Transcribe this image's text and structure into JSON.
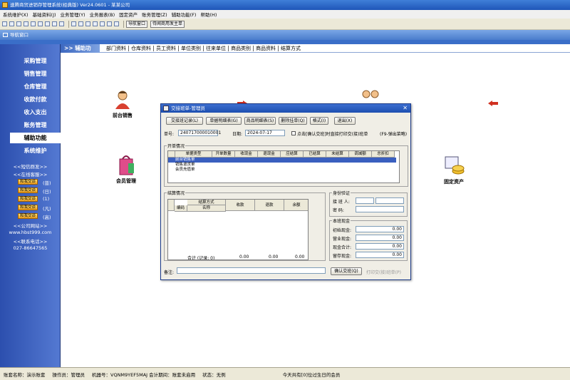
{
  "window": {
    "title": "速腾商贸进销存管理系统(经典版) Ver24.0601 - 某某公司"
  },
  "menu": [
    "系统维护(X)",
    "基础资料(J)",
    "业务管理(Y)",
    "业务报表(B)",
    "固定资产",
    "账务管理(Z)",
    "辅助功能(F)",
    "帮助(H)"
  ],
  "toolbar": {
    "btn_nav": "导航窗口",
    "btn_forum": "侍闻商用发主单"
  },
  "nav": {
    "title": "导航窗口"
  },
  "sidebar": {
    "items": [
      "采购管理",
      "销售管理",
      "仓库管理",
      "收款付款",
      "收入支出",
      "账务管理",
      "辅助功能",
      "系统维护"
    ],
    "active": "辅助功能",
    "sms": "<<短信群发>>",
    "online": "<<在线客服>>",
    "qq": [
      {
        "badge": "和我交谈",
        "label": "(普)"
      },
      {
        "badge": "和我交谈",
        "label": "(日)"
      },
      {
        "badge": "和我交谈",
        "label": "(1)"
      },
      {
        "badge": "和我交谈",
        "label": "(凡)"
      },
      {
        "badge": "和我交谈",
        "label": "(高)"
      }
    ],
    "website_label": "<<公司网站>>",
    "website": "www.hbst999.com",
    "phone_label": "<<联系电话>>",
    "phone": "027-86647565"
  },
  "tabs": {
    "header": ">> 辅助功能",
    "items": [
      "部门资料",
      "仓库资料",
      "员工资料",
      "单位类别",
      "往来单位",
      "商品类别",
      "商品资料",
      "结算方式"
    ]
  },
  "modules": {
    "front_sales": "前台销售",
    "member": "会员管理",
    "fixed_assets": "固定资产"
  },
  "dialog": {
    "title": "交接班单-管理员",
    "buttons": [
      "交接班记录(L)",
      "单据明细表(G)",
      "商品明细表(S)",
      "删除挂单(Q)",
      "格式(I)",
      "退出(X)"
    ],
    "bill_no_label": "单号:",
    "bill_no": "240717000010001",
    "date_label": "日期:",
    "date": "2024-07-17",
    "print_option": "点击[确认交班]时直接打印交(接)班单",
    "f9_hint": "(F9-弹出菜略)",
    "open_section": "开单情况",
    "open_cols": [
      "单据类型",
      "开单数量",
      "收现金",
      "退现金",
      "应结算",
      "已结算",
      "未结算",
      "调减额",
      "总折扣"
    ],
    "open_rows": [
      "前台销售单",
      "销售退货单",
      "会员充值单"
    ],
    "settle_section": "结算情况",
    "settle_cols": [
      "编码",
      "结算方式",
      "名称",
      "收款",
      "退款",
      "余额"
    ],
    "settle_total_label": "合计 (记录: 0)",
    "settle_totals": [
      "0.00",
      "0.00",
      "0.00"
    ],
    "identity_section": "身份验证",
    "handover_label": "接 班 人:",
    "password_label": "密   码:",
    "cash_section": "本班现金",
    "cash_items": [
      {
        "label": "初始现金:",
        "value": "0.00"
      },
      {
        "label": "营业现金:",
        "value": "0.00"
      },
      {
        "label": "现金合计:",
        "value": "0.00"
      },
      {
        "label": "留存现金:",
        "value": "0.00"
      }
    ],
    "memo_label": "备注:",
    "confirm_btn": "确认交班(Q)",
    "print_btn": "打印交(接)班单(P)"
  },
  "status": {
    "account": "账套名称：演示账套",
    "operator": "操作员：管理员",
    "machine": "机器号：VQNM9YEF5MAJ 会计期间：账套未启用",
    "state": "状态：无例",
    "birthday": "今天共有[0]位过生日的会员"
  }
}
